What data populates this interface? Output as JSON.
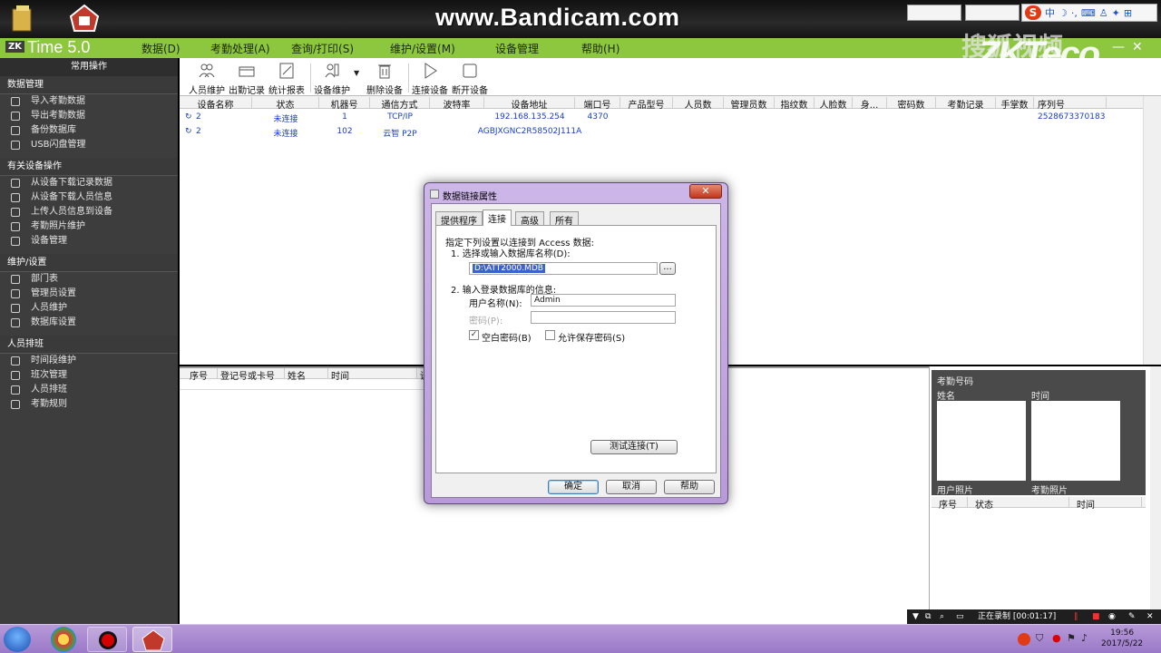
{
  "watermark": {
    "recorder": "www.Bandicam.com",
    "site": "搜狐视频",
    "brand": "ZKTeco"
  },
  "ime": {
    "lang": "中"
  },
  "app": {
    "logo_zk": "ZK",
    "logo_time": "Time 5.0"
  },
  "menu": [
    "数据(D)",
    "考勤处理(A)",
    "查询/打印(S)",
    "维护/设置(M)",
    "设备管理",
    "帮助(H)"
  ],
  "sidebar": {
    "header": "常用操作",
    "sections": [
      {
        "title": "数据管理",
        "items": [
          "导入考勤数据",
          "导出考勤数据",
          "备份数据库",
          "USB闪盘管理"
        ]
      },
      {
        "title": "有关设备操作",
        "items": [
          "从设备下载记录数据",
          "从设备下载人员信息",
          "上传人员信息到设备",
          "考勤照片维护",
          "设备管理"
        ]
      },
      {
        "title": "维护/设置",
        "items": [
          "部门表",
          "管理员设置",
          "人员维护",
          "数据库设置"
        ]
      },
      {
        "title": "人员排班",
        "items": [
          "时间段维护",
          "班次管理",
          "人员排班",
          "考勤规则"
        ]
      }
    ]
  },
  "toolbar": {
    "buttons": [
      "人员维护",
      "出勤记录",
      "统计报表",
      "设备维护",
      "删除设备",
      "连接设备",
      "断开设备"
    ]
  },
  "grid": {
    "columns": [
      "设备名称",
      "状态",
      "机器号",
      "通信方式",
      "波特率",
      "设备地址",
      "端口号",
      "产品型号",
      "人员数",
      "管理员数",
      "指纹数",
      "人脸数",
      "身...",
      "密码数",
      "考勤记录",
      "手掌数",
      "序列号"
    ],
    "rows": [
      {
        "name": "2",
        "status": "未连接",
        "machine": "1",
        "comm": "TCP/IP",
        "baud": "",
        "address": "192.168.135.254",
        "port": "4370",
        "serial": "2528673370183"
      },
      {
        "name": "2",
        "status": "未连接",
        "machine": "102",
        "comm": "云智 P2P",
        "baud": "",
        "address": "AGBJXGNC2R58502J111A",
        "port": "",
        "serial": ""
      }
    ]
  },
  "log": {
    "columns": [
      "序号",
      "登记号或卡号",
      "姓名",
      "时间",
      "设"
    ]
  },
  "photo": {
    "header": "考勤号码",
    "name_label": "姓名",
    "time_label": "时间",
    "user_photo": "用户照片",
    "att_photo": "考勤照片",
    "table": [
      "序号",
      "状态",
      "时间"
    ]
  },
  "dialog": {
    "title": "数据链接属性",
    "tabs": [
      "提供程序",
      "连接",
      "高级",
      "所有"
    ],
    "intro": "指定下列设置以连接到 Access 数据:",
    "step1": "1. 选择或输入数据库名称(D):",
    "db_path": "D:\\ATT2000.MDB",
    "browse": "...",
    "step2": "2. 输入登录数据库的信息:",
    "user_label": "用户名称(N):",
    "user_value": "Admin",
    "pwd_label": "密码(P):",
    "blank_pwd": "空白密码(B)",
    "save_pwd": "允许保存密码(S)",
    "test": "测试连接(T)",
    "ok": "确定",
    "cancel": "取消",
    "help": "帮助"
  },
  "recording": {
    "status": "正在录制 [00:01:17]"
  },
  "clock": {
    "time": "19:56",
    "date": "2017/5/22"
  }
}
